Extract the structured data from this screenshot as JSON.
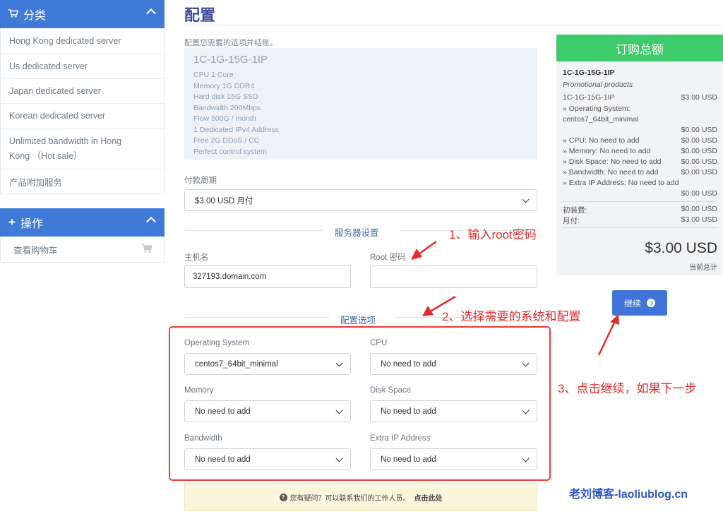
{
  "sidebar": {
    "categories": {
      "title": "分类",
      "items": [
        "Hong Kong dedicated server",
        "Us dedicated server",
        "Japan dedicated server",
        "Korean dedicated server",
        "Unlimited bandwidth in Hong Kong （Hot sale）",
        "产品附加服务"
      ]
    },
    "actions": {
      "title": "操作",
      "items": [
        "查看购物车"
      ]
    }
  },
  "main": {
    "title": "配置",
    "intro": "配置您需要的选项并结账。",
    "product": {
      "name": "1C-1G-15G-1IP",
      "features": [
        "CPU 1 Core",
        "Memory 1G DDR4",
        "Hard disk 15G SSD",
        "Bandwidth 200Mbps",
        "Flow 500G / month",
        "1 Dedicated IPv4 Address",
        "Free 2G DDoS / CC",
        "Perfect control system"
      ]
    },
    "billing": {
      "label": "付款周期",
      "value": "$3.00 USD 月付"
    },
    "server_settings": {
      "title": "服务器设置",
      "hostname_label": "主机名",
      "hostname_value": "327193.domain.com",
      "root_label": "Root 密码",
      "root_value": ""
    },
    "config_options": {
      "title": "配置选项",
      "fields": [
        {
          "label": "Operating System",
          "value": "centos7_64bit_minimal"
        },
        {
          "label": "CPU",
          "value": "No need to add"
        },
        {
          "label": "Memory",
          "value": "No need to add"
        },
        {
          "label": "Disk Space",
          "value": "No need to add"
        },
        {
          "label": "Bandwidth",
          "value": "No need to add"
        },
        {
          "label": "Extra IP Address",
          "value": "No need to add"
        }
      ]
    },
    "help": {
      "text": "您有疑问？可以联系我们的工作人员。",
      "link": "点击此处"
    }
  },
  "summary": {
    "title": "订购总额",
    "product": "1C-1G-15G-1IP",
    "group": "Promotional products",
    "base_item": "1C-1G-15G-1IP",
    "base_price": "$3.00 USD",
    "os_label": "» Operating System:",
    "os_value": "centos7_64bit_minimal",
    "os_price": "$0.00 USD",
    "lines": [
      {
        "label": "» CPU: No need to add",
        "price": "$0.00 USD"
      },
      {
        "label": "» Memory: No need to add",
        "price": "$0.00 USD"
      },
      {
        "label": "» Disk Space: No need to add",
        "price": "$0.00 USD"
      },
      {
        "label": "» Bandwidth: No need to add",
        "price": "$0.00 USD"
      },
      {
        "label": "» Extra IP Address: No need to add",
        "price": ""
      }
    ],
    "extra_price": "$0.00 USD",
    "setup_label": "初装费:",
    "setup_price": "$0.00 USD",
    "monthly_label": "月付:",
    "monthly_price": "$3.00 USD",
    "total": "$3.00 USD",
    "total_label": "当前总计"
  },
  "continue_label": "继续",
  "annotations": {
    "step1": "1、输入root密码",
    "step2": "2、选择需要的系统和配置",
    "step3": "3、点击继续，如果下一步"
  },
  "watermark": "老刘博客-laoliublog.cn",
  "colors": {
    "accent": "#3f7ad8",
    "summary_head": "#3dcb6c",
    "annotation": "#e22b2b"
  }
}
